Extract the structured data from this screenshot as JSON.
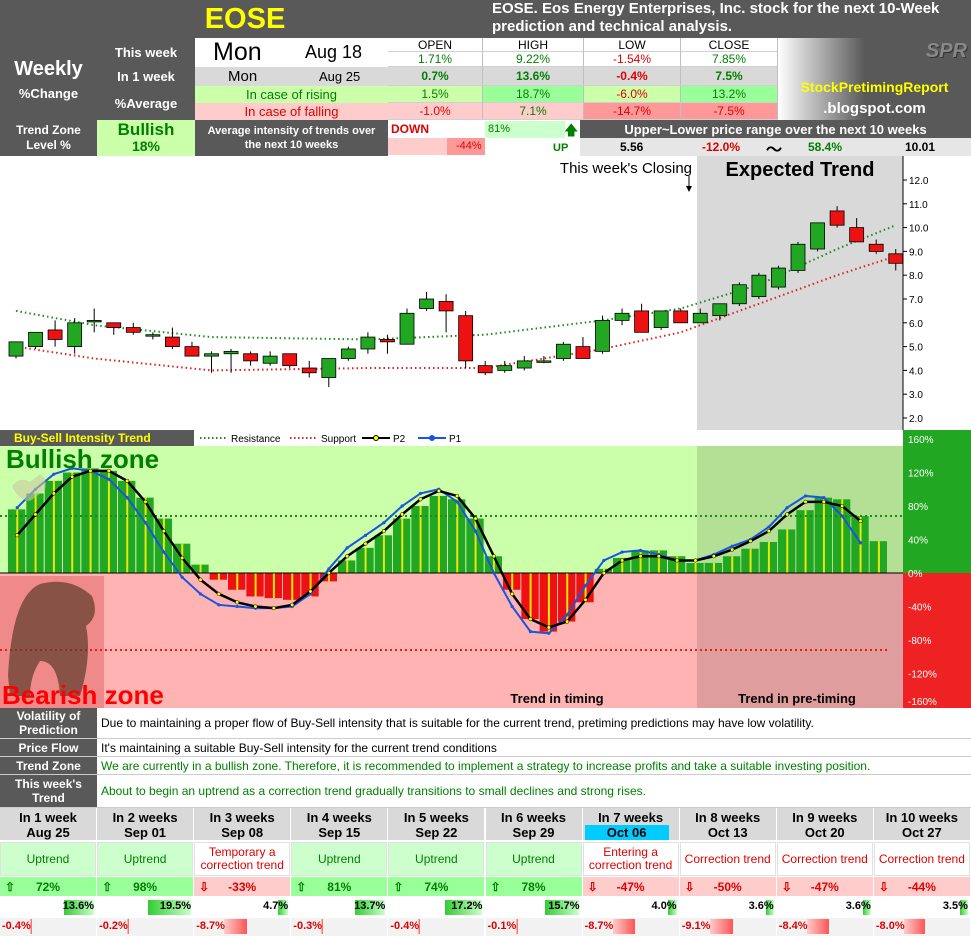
{
  "header": {
    "ticker": "EOSE",
    "title": "EOSE. Eos Energy Enterprises, Inc.  stock for the next 10-Week prediction and technical analysis.",
    "spr": "SPR",
    "blog1": "StockPretimingReport",
    "blog2": ".blogspot.com"
  },
  "table": {
    "weekly": "Weekly",
    "pct_change": "%Change",
    "this_week": "This week",
    "in_1_week": "In 1 week",
    "pct_average": "%Average",
    "day": "Mon",
    "date": "Aug 18",
    "day2": "Mon",
    "date2": "Aug 25",
    "cols": [
      "OPEN",
      "HIGH",
      "LOW",
      "CLOSE"
    ],
    "row1": [
      "1.71%",
      "9.22%",
      "-1.54%",
      "7.85%"
    ],
    "row2": [
      "0.7%",
      "13.6%",
      "-0.4%",
      "7.5%"
    ],
    "rising_label": "In case of rising",
    "rising": [
      "1.5%",
      "18.7%",
      "-6.0%",
      "13.2%"
    ],
    "falling_label": "In case of falling",
    "falling": [
      "-1.0%",
      "7.1%",
      "-14.7%",
      "-7.5%"
    ]
  },
  "trend_zone": {
    "label1": "Trend Zone",
    "label2": "Level %",
    "value": "Bullish",
    "level": "18%",
    "avg_text": "Average intensity of trends over the next 10 weeks",
    "down": "DOWN",
    "down_pct": "-44%",
    "up": "UP",
    "up_pct": "81%",
    "range_title": "Upper~Lower price range over the next 10 weeks",
    "low_price": "5.56",
    "low_pct": "-12.0%",
    "tilde": "〜",
    "high_pct": "58.4%",
    "high_price": "10.01"
  },
  "colors": {
    "green": "#22a722",
    "red": "#ee1111",
    "bull_bg": "#ccffaa",
    "bear_bg": "#ffb3b3"
  },
  "labels": {
    "closing": "This week's Closing",
    "expected": "Expected Trend",
    "bsi": "Buy-Sell Intensity Trend",
    "bull": "Bullish zone",
    "bear": "Bearish zone",
    "timing": "Trend in timing",
    "pretiming": "Trend in pre-timing",
    "legend": [
      "Resistance",
      "Support",
      "P2",
      "P1"
    ]
  },
  "chart_data": {
    "type": "candlestick",
    "price_axis": {
      "min": 2.0,
      "max": 12.0,
      "ticks": [
        "12.0",
        "11.0",
        "10.0",
        "9.0",
        "8.0",
        "7.0",
        "6.0",
        "5.0",
        "4.0",
        "3.0",
        "2.0"
      ]
    },
    "candles": [
      [
        4.6,
        5.2,
        4.5,
        5.2
      ],
      [
        5.0,
        5.6,
        4.9,
        5.6
      ],
      [
        5.7,
        6.1,
        5.0,
        5.3
      ],
      [
        5.0,
        6.2,
        4.7,
        6.0
      ],
      [
        6.1,
        6.6,
        5.6,
        6.1
      ],
      [
        6.0,
        6.0,
        5.5,
        5.8
      ],
      [
        5.8,
        6.0,
        5.5,
        5.6
      ],
      [
        5.5,
        5.6,
        5.3,
        5.5
      ],
      [
        5.4,
        5.8,
        4.9,
        5.0
      ],
      [
        5.0,
        5.2,
        4.7,
        4.6
      ],
      [
        4.6,
        4.8,
        3.9,
        4.7
      ],
      [
        4.7,
        4.9,
        3.9,
        4.8
      ],
      [
        4.7,
        4.8,
        4.2,
        4.4
      ],
      [
        4.3,
        4.8,
        4.2,
        4.6
      ],
      [
        4.7,
        4.7,
        4.1,
        4.2
      ],
      [
        4.1,
        4.4,
        3.7,
        3.9
      ],
      [
        3.7,
        4.5,
        3.3,
        4.5
      ],
      [
        4.5,
        5.0,
        4.4,
        4.9
      ],
      [
        4.9,
        5.6,
        4.7,
        5.4
      ],
      [
        5.3,
        5.5,
        4.7,
        5.2
      ],
      [
        5.1,
        6.6,
        5.1,
        6.4
      ],
      [
        6.6,
        7.3,
        6.5,
        7.0
      ],
      [
        6.9,
        7.2,
        5.6,
        6.5
      ],
      [
        6.3,
        6.5,
        4.1,
        4.4
      ],
      [
        4.2,
        4.4,
        3.8,
        3.9
      ],
      [
        4.0,
        4.4,
        3.9,
        4.2
      ],
      [
        4.1,
        4.6,
        4.0,
        4.4
      ],
      [
        4.4,
        4.6,
        4.3,
        4.4
      ],
      [
        4.5,
        5.2,
        4.4,
        5.1
      ],
      [
        5.0,
        5.4,
        4.6,
        4.5
      ],
      [
        4.8,
        6.3,
        4.7,
        6.1
      ],
      [
        6.1,
        6.6,
        5.9,
        6.4
      ],
      [
        6.5,
        6.8,
        5.6,
        5.6
      ],
      [
        5.8,
        6.5,
        5.7,
        6.5
      ],
      [
        6.5,
        6.6,
        6.0,
        6.0
      ],
      [
        6.0,
        6.6,
        6.0,
        6.4
      ],
      [
        6.3,
        6.7,
        6.1,
        6.8
      ],
      [
        6.8,
        7.7,
        6.7,
        7.6
      ],
      [
        7.1,
        8.1,
        7.0,
        8.0
      ],
      [
        7.5,
        8.4,
        7.4,
        8.3
      ],
      [
        8.2,
        9.4,
        8.1,
        9.3
      ],
      [
        9.1,
        10.2,
        9.0,
        10.2
      ],
      [
        10.7,
        10.9,
        10.0,
        10.1
      ],
      [
        10.0,
        10.4,
        9.4,
        9.4
      ],
      [
        9.3,
        9.5,
        8.9,
        9.0
      ],
      [
        8.9,
        9.1,
        8.2,
        8.5
      ]
    ],
    "resistance": [
      [
        0,
        6.5
      ],
      [
        4,
        5.9
      ],
      [
        10,
        5.4
      ],
      [
        18,
        5.3
      ],
      [
        24,
        5.5
      ],
      [
        30,
        6.1
      ],
      [
        34,
        6.6
      ],
      [
        38,
        7.6
      ],
      [
        42,
        9.1
      ],
      [
        45,
        10.1
      ]
    ],
    "support": [
      [
        0,
        5.0
      ],
      [
        4,
        4.5
      ],
      [
        10,
        4.0
      ],
      [
        18,
        4.1
      ],
      [
        24,
        4.1
      ],
      [
        30,
        4.9
      ],
      [
        34,
        5.6
      ],
      [
        38,
        6.8
      ],
      [
        42,
        8.0
      ],
      [
        45,
        8.8
      ]
    ],
    "intensity_axis": {
      "min": -160,
      "max": 160,
      "ticks": [
        "160%",
        "120%",
        "80%",
        "40%",
        "0%",
        "-40%",
        "-80%",
        "-120%",
        "-160%"
      ]
    },
    "bars": [
      76,
      95,
      110,
      120,
      125,
      122,
      110,
      90,
      65,
      35,
      10,
      -8,
      -20,
      -28,
      -30,
      -32,
      -28,
      -10,
      15,
      30,
      45,
      65,
      80,
      92,
      88,
      65,
      20,
      -20,
      -55,
      -70,
      -58,
      -35,
      5,
      18,
      27,
      27,
      20,
      12,
      12,
      20,
      29,
      37,
      52,
      75,
      90,
      88,
      68,
      38
    ],
    "p1": [
      78,
      100,
      118,
      125,
      122,
      112,
      90,
      60,
      25,
      -5,
      -25,
      -38,
      -40,
      -42,
      -42,
      -40,
      -25,
      5,
      30,
      45,
      60,
      80,
      95,
      100,
      85,
      50,
      0,
      -40,
      -70,
      -72,
      -50,
      -15,
      15,
      25,
      27,
      22,
      15,
      15,
      22,
      32,
      40,
      55,
      78,
      92,
      90,
      68,
      36
    ],
    "p2": [
      45,
      70,
      95,
      115,
      122,
      122,
      110,
      85,
      50,
      18,
      -8,
      -25,
      -35,
      -40,
      -42,
      -38,
      -22,
      0,
      20,
      35,
      50,
      70,
      88,
      98,
      92,
      65,
      20,
      -25,
      -55,
      -65,
      -58,
      -32,
      0,
      15,
      20,
      20,
      15,
      15,
      20,
      28,
      38,
      50,
      70,
      85,
      85,
      80,
      62
    ],
    "threshold_up": 68,
    "threshold_down": -92
  },
  "rows": [
    {
      "h": "Volatility of Prediction",
      "t": "Due to maintaining a proper flow of Buy-Sell intensity that is suitable for the current trend, pretiming predictions may have low volatility.",
      "c": "#000"
    },
    {
      "h": "Price Flow",
      "t": "It's maintaining a suitable Buy-Sell intensity for the current trend conditions",
      "c": "#000"
    },
    {
      "h": "Trend Zone",
      "t": "We are currently in a bullish zone. Therefore, it is recommended to implement a strategy to increase profits and take a suitable investing position.",
      "c": "#008000"
    },
    {
      "h": "This week's Trend",
      "t": "About to begin an uptrend as a correction trend gradually transitions to small declines and strong rises.",
      "c": "#008000"
    }
  ],
  "forecast": [
    {
      "w": "In 1 week",
      "d": "Aug 25",
      "trend": "Uptrend",
      "up": true,
      "pct": "72%",
      "hi": "13.6%",
      "lo": "-0.4%",
      "hiv": 13.6,
      "lov": 0.4
    },
    {
      "w": "In 2 weeks",
      "d": "Sep 01",
      "trend": "Uptrend",
      "up": true,
      "pct": "98%",
      "hi": "19.5%",
      "lo": "-0.2%",
      "hiv": 19.5,
      "lov": 0.2
    },
    {
      "w": "In 3 weeks",
      "d": "Sep 08",
      "trend": "Temporary a correction trend",
      "up": false,
      "pct": "-33%",
      "hi": "4.7%",
      "lo": "-8.7%",
      "hiv": 4.7,
      "lov": 8.7
    },
    {
      "w": "In 4 weeks",
      "d": "Sep 15",
      "trend": "Uptrend",
      "up": true,
      "pct": "81%",
      "hi": "13.7%",
      "lo": "-0.3%",
      "hiv": 13.7,
      "lov": 0.3
    },
    {
      "w": "In 5 weeks",
      "d": "Sep 22",
      "trend": "Uptrend",
      "up": true,
      "pct": "74%",
      "hi": "17.2%",
      "lo": "-0.4%",
      "hiv": 17.2,
      "lov": 0.4
    },
    {
      "w": "In 6 weeks",
      "d": "Sep 29",
      "trend": "Uptrend",
      "up": true,
      "pct": "78%",
      "hi": "15.7%",
      "lo": "-0.1%",
      "hiv": 15.7,
      "lov": 0.1
    },
    {
      "w": "In 7 weeks",
      "d": "Oct 06",
      "trend": "Entering a correction trend",
      "up": false,
      "pct": "-47%",
      "hi": "4.0%",
      "lo": "-8.7%",
      "hiv": 4.0,
      "lov": 8.7,
      "hl": true
    },
    {
      "w": "In 8 weeks",
      "d": "Oct 13",
      "trend": "Correction trend",
      "up": false,
      "pct": "-50%",
      "hi": "3.6%",
      "lo": "-9.1%",
      "hiv": 3.6,
      "lov": 9.1
    },
    {
      "w": "In 9 weeks",
      "d": "Oct 20",
      "trend": "Correction trend",
      "up": false,
      "pct": "-47%",
      "hi": "3.6%",
      "lo": "-8.4%",
      "hiv": 3.6,
      "lov": 8.4
    },
    {
      "w": "In 10 weeks",
      "d": "Oct 27",
      "trend": "Correction trend",
      "up": false,
      "pct": "-44%",
      "hi": "3.5%",
      "lo": "-8.0%",
      "hiv": 3.5,
      "lov": 8.0
    }
  ]
}
